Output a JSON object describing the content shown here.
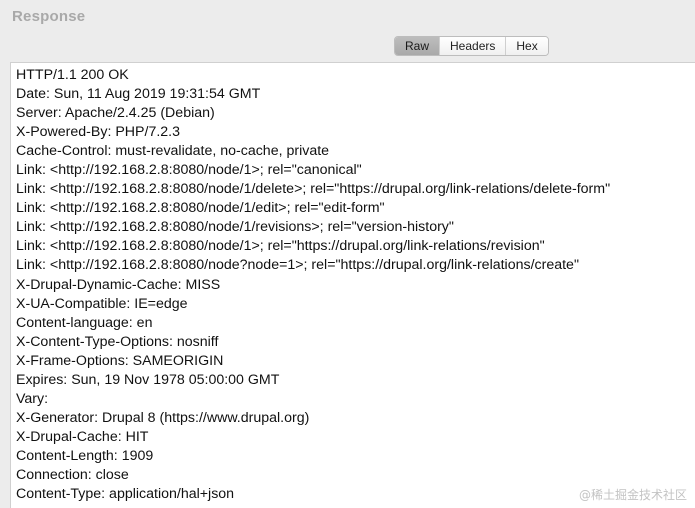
{
  "panel": {
    "title": "Response"
  },
  "tabs": [
    {
      "label": "Raw",
      "active": true
    },
    {
      "label": "Headers",
      "active": false
    },
    {
      "label": "Hex",
      "active": false
    }
  ],
  "response_lines": [
    "HTTP/1.1 200 OK",
    "Date: Sun, 11 Aug 2019 19:31:54 GMT",
    "Server: Apache/2.4.25 (Debian)",
    "X-Powered-By: PHP/7.2.3",
    "Cache-Control: must-revalidate, no-cache, private",
    "Link: <http://192.168.2.8:8080/node/1>; rel=\"canonical\"",
    "Link: <http://192.168.2.8:8080/node/1/delete>; rel=\"https://drupal.org/link-relations/delete-form\"",
    "Link: <http://192.168.2.8:8080/node/1/edit>; rel=\"edit-form\"",
    "Link: <http://192.168.2.8:8080/node/1/revisions>; rel=\"version-history\"",
    "Link: <http://192.168.2.8:8080/node/1>; rel=\"https://drupal.org/link-relations/revision\"",
    "Link: <http://192.168.2.8:8080/node?node=1>; rel=\"https://drupal.org/link-relations/create\"",
    "X-Drupal-Dynamic-Cache: MISS",
    "X-UA-Compatible: IE=edge",
    "Content-language: en",
    "X-Content-Type-Options: nosniff",
    "X-Frame-Options: SAMEORIGIN",
    "Expires: Sun, 19 Nov 1978 05:00:00 GMT",
    "Vary:",
    "X-Generator: Drupal 8 (https://www.drupal.org)",
    "X-Drupal-Cache: HIT",
    "Content-Length: 1909",
    "Connection: close",
    "Content-Type: application/hal+json"
  ],
  "watermark": "@稀土掘金技术社区"
}
